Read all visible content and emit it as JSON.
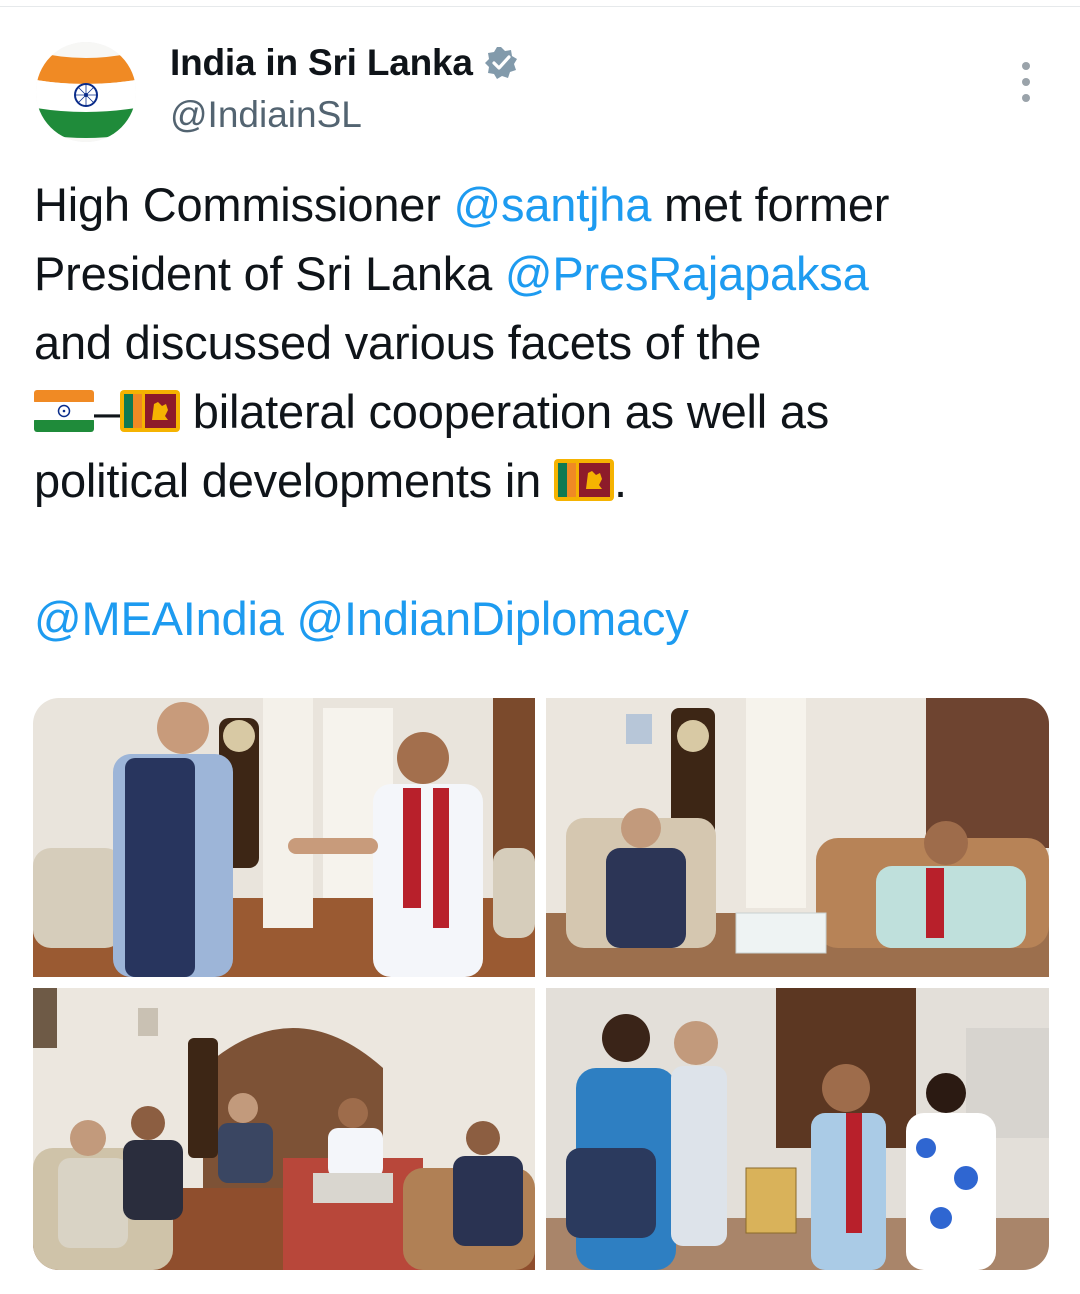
{
  "account": {
    "display_name": "India in Sri Lanka",
    "handle": "@IndiainSL",
    "avatar": "india-flag-avatar",
    "verified": true
  },
  "tweet": {
    "line1": {
      "a": "High Commissioner ",
      "m": "@santjha",
      "b": " met former"
    },
    "line2": {
      "a": "President of Sri Lanka ",
      "m": "@PresRajapaksa"
    },
    "line3": "and discussed various facets of the",
    "line4": {
      "dash": "–",
      "b": " bilateral cooperation as well as"
    },
    "line5": {
      "a": "political developments in ",
      "b": "."
    },
    "mentions_line": {
      "m1": "@MEAIndia",
      "m2": "@IndianDiplomacy"
    }
  },
  "emoji": [
    "flag-india",
    "flag-sri-lanka",
    "flag-sri-lanka"
  ],
  "media": {
    "count": 4,
    "items": [
      "photo-handshake",
      "photo-seated-conversation",
      "photo-delegation-meeting",
      "photo-greeting"
    ]
  },
  "colors": {
    "link": "#1d9bf0",
    "text": "#0f1419",
    "secondary": "#536471",
    "verified": "#829aab"
  }
}
